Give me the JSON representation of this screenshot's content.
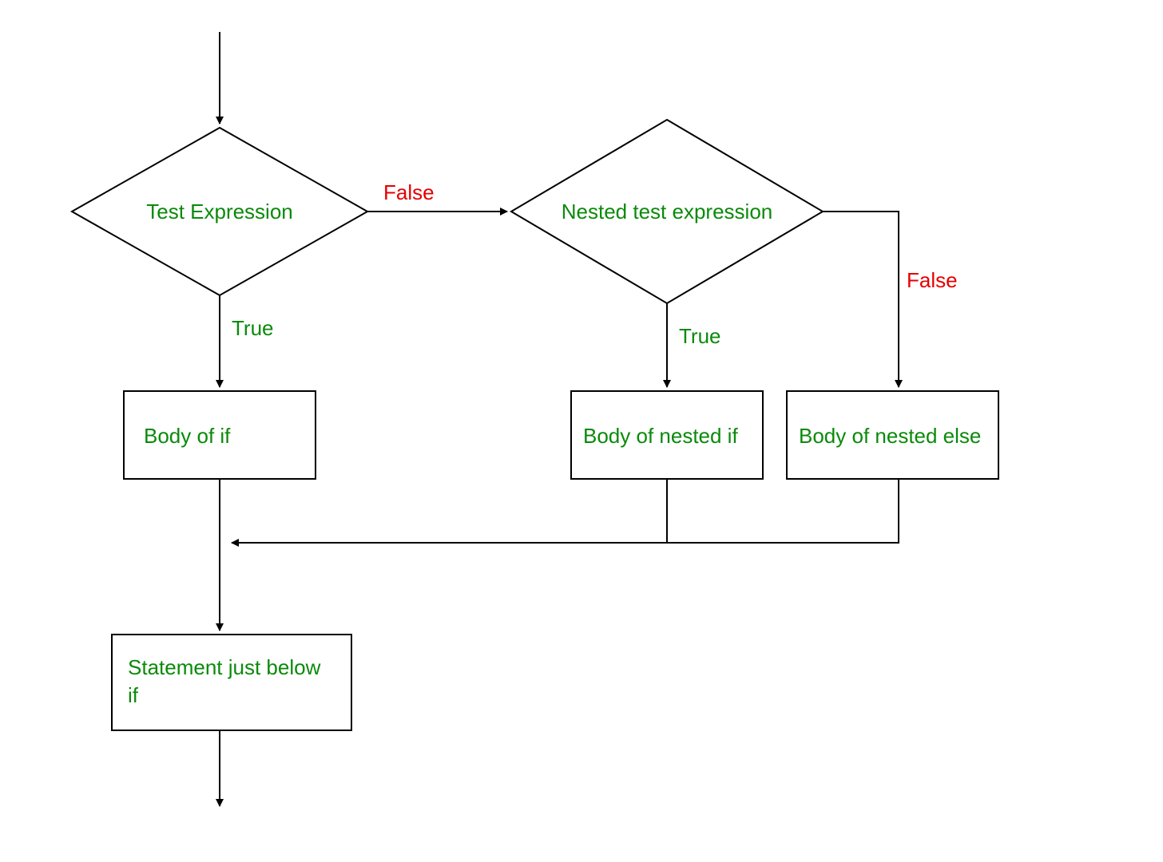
{
  "diagram": {
    "type": "flowchart",
    "description": "Nested if/else flowchart",
    "nodes": {
      "test_expression": {
        "label": "Test Expression",
        "shape": "decision"
      },
      "nested_test_expression": {
        "label": "Nested test expression",
        "shape": "decision"
      },
      "body_of_if": {
        "label": "Body of if",
        "shape": "process"
      },
      "body_of_nested_if": {
        "label": "Body of nested if",
        "shape": "process"
      },
      "body_of_nested_else": {
        "label": "Body of nested else",
        "shape": "process"
      },
      "statement_below_if": {
        "label_line1": "Statement just below",
        "label_line2": "if",
        "shape": "process"
      }
    },
    "edges": {
      "te_true": {
        "from": "test_expression",
        "to": "body_of_if",
        "label": "True",
        "condition": true
      },
      "te_false": {
        "from": "test_expression",
        "to": "nested_test_expression",
        "label": "False",
        "condition": false
      },
      "nte_true": {
        "from": "nested_test_expression",
        "to": "body_of_nested_if",
        "label": "True",
        "condition": true
      },
      "nte_false": {
        "from": "nested_test_expression",
        "to": "body_of_nested_else",
        "label": "False",
        "condition": false
      }
    },
    "colors": {
      "node_text": "#0a8a0a",
      "true_label": "#0a8a0a",
      "false_label": "#e60000",
      "stroke": "#000000",
      "fill": "#ffffff"
    }
  }
}
